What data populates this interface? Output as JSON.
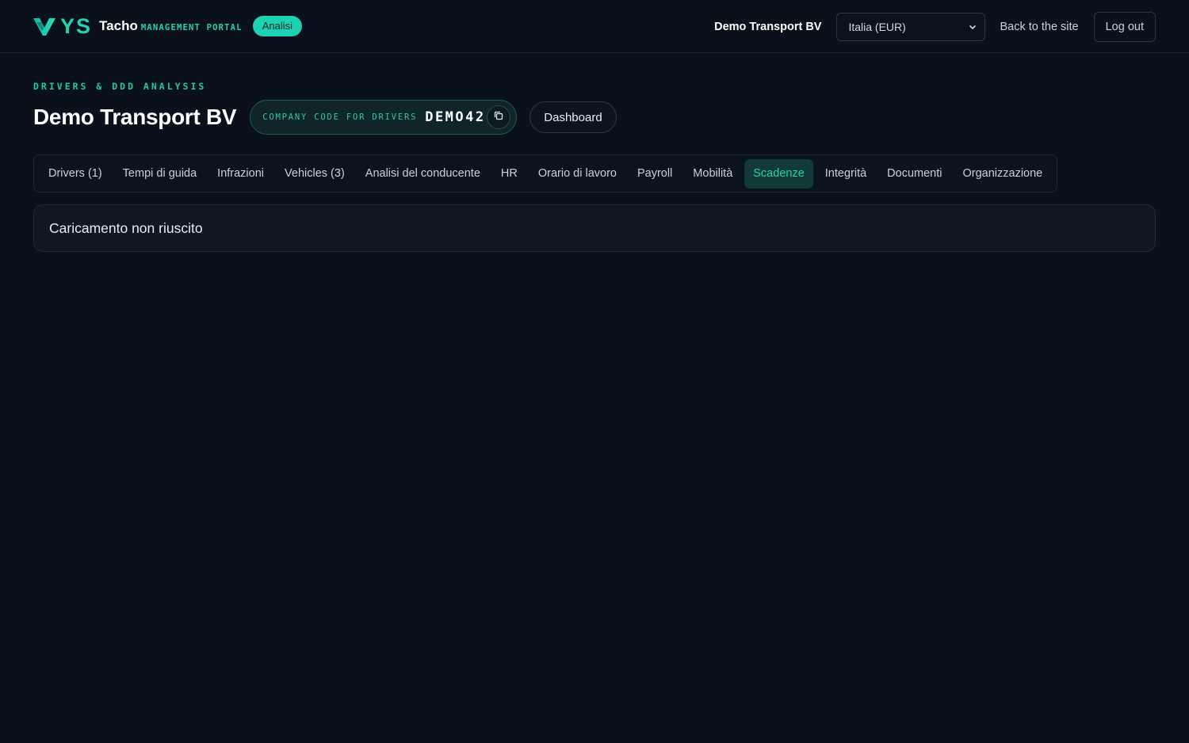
{
  "brand": {
    "name": "Tacho",
    "subtitle": "MANAGEMENT PORTAL",
    "badge": "Analisi",
    "logo_letters": "YS",
    "accent_color": "#1fd1b2"
  },
  "topbar": {
    "company_name": "Demo Transport BV",
    "region_select": {
      "selected": "Italia (EUR)"
    },
    "back_link": "Back to the site",
    "logout_label": "Log out"
  },
  "header": {
    "eyebrow": "DRIVERS & DDD ANALYSIS",
    "title": "Demo Transport BV",
    "company_code_label": "COMPANY CODE FOR DRIVERS",
    "company_code": "DEMO42",
    "dashboard_label": "Dashboard"
  },
  "tabs": [
    {
      "label": "Drivers (1)",
      "active": false
    },
    {
      "label": "Tempi di guida",
      "active": false
    },
    {
      "label": "Infrazioni",
      "active": false
    },
    {
      "label": "Vehicles (3)",
      "active": false
    },
    {
      "label": "Analisi del conducente",
      "active": false
    },
    {
      "label": "HR",
      "active": false
    },
    {
      "label": "Orario di lavoro",
      "active": false
    },
    {
      "label": "Payroll",
      "active": false
    },
    {
      "label": "Mobilità",
      "active": false
    },
    {
      "label": "Scadenze",
      "active": true
    },
    {
      "label": "Integrità",
      "active": false
    },
    {
      "label": "Documenti",
      "active": false
    },
    {
      "label": "Organizzazione",
      "active": false
    }
  ],
  "panel": {
    "message": "Caricamento non riuscito"
  },
  "icons": {
    "logo": "vys-logo-icon",
    "dropdown": "chevron-down-icon",
    "copy": "copy-icon"
  }
}
